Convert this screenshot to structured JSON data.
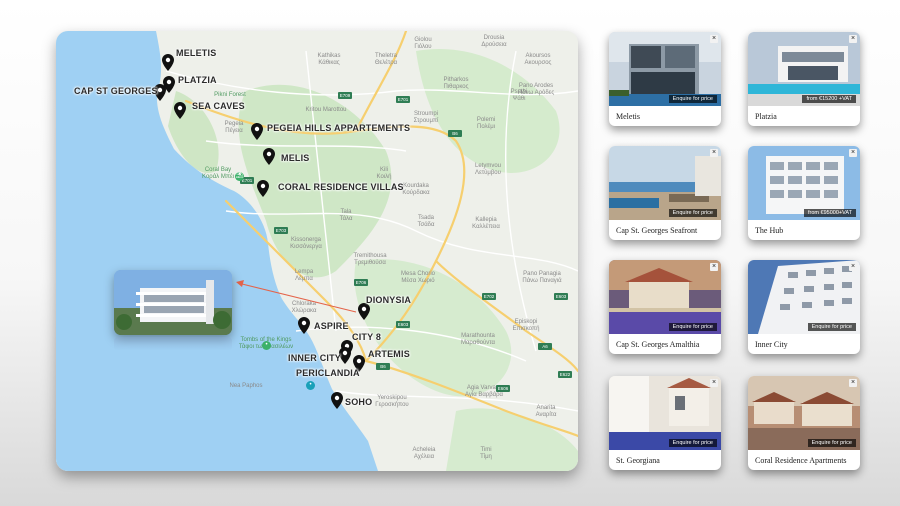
{
  "map": {
    "pins": [
      {
        "label": "MELETIS"
      },
      {
        "label": "PLATZIA"
      },
      {
        "label": "CAP ST GEORGES"
      },
      {
        "label": "SEA CAVES"
      },
      {
        "label": "PEGEIA HILLS APPARTEMENTS"
      },
      {
        "label": "MELIS"
      },
      {
        "label": "CORAL RESIDENCE VILLAS"
      },
      {
        "label": "DIONYSIA"
      },
      {
        "label": "ASPIRE"
      },
      {
        "label": "CITY 8"
      },
      {
        "label": "INNER CITY"
      },
      {
        "label": "ARTEMIS"
      },
      {
        "label": "PERICLANDIA"
      },
      {
        "label": "SOHO"
      }
    ],
    "places": [
      {
        "text": "Giolou\nΓιόλου"
      },
      {
        "text": "Drousia\nΔρούσεια"
      },
      {
        "text": "Kathikas\nΚάθικας"
      },
      {
        "text": "Theletra\nΘελέτρα"
      },
      {
        "text": "Akoursos\nΑκουρσος"
      },
      {
        "text": "Pano Arodes\nΠάνω Αρόδες"
      },
      {
        "text": "Pitharkos\nΠιθαρκος"
      },
      {
        "text": "Psathi\nΨάθι"
      },
      {
        "text": "Kritou Marottou"
      },
      {
        "text": "Pikni Forest"
      },
      {
        "text": "Pegeia\nΠέγεια"
      },
      {
        "text": "Stroumpi\nΣτρουμπί"
      },
      {
        "text": "Polemi\nΠολέμι"
      },
      {
        "text": "Kili\nΚοιλή"
      },
      {
        "text": "Letymvou\nΛετύμβου"
      },
      {
        "text": "Kourdaka\nΚούρδακα"
      },
      {
        "text": "Kallepia\nΚαλλέπεια"
      },
      {
        "text": "Tala\nΤάλα"
      },
      {
        "text": "Tsada\nΤσάδα"
      },
      {
        "text": "Coral Bay\nΚοράλ Μπέι"
      },
      {
        "text": "Kissonerga\nΚισσόνεργα"
      },
      {
        "text": "Tremithousa\nΤρεμιθούσα"
      },
      {
        "text": "Mesa Chorio\nΜέσα Χωριό"
      },
      {
        "text": "Lempa\nΛέμπα"
      },
      {
        "text": "Chloraka\nΧλώρακα"
      },
      {
        "text": "Marathounta\nΜαραθούντα"
      },
      {
        "text": "Tombs of the Kings\nΤάφοι των Βασιλέων"
      },
      {
        "text": "Nea Paphos"
      },
      {
        "text": "Agia Varvara\nΑγία Βαρβάρα"
      },
      {
        "text": "Yeroskipou\nΓεροσκήπου"
      },
      {
        "text": "Acheleia\nΑχέλεια"
      },
      {
        "text": "Timi\nΤίμη"
      },
      {
        "text": "Anarita\nΑναρίτα"
      },
      {
        "text": "Episkopi\nΕπισκοπή"
      },
      {
        "text": "Pano Panagia\nΠάνω Παναγιά"
      }
    ],
    "roads": [
      "E709",
      "E701",
      "B6",
      "E701",
      "E703",
      "E706",
      "E702",
      "E603",
      "E606",
      "E622",
      "B6",
      "A6",
      "E603"
    ]
  },
  "cards": [
    {
      "name": "Meletis",
      "tag": "Enquire for price"
    },
    {
      "name": "Platzia",
      "tag": "from €15200 +VAT"
    },
    {
      "name": "Cap St. Georges Seafront",
      "tag": "Enquire for price"
    },
    {
      "name": "The Hub",
      "tag": "from €95000+VAT"
    },
    {
      "name": "Cap St. Georges Amalthia",
      "tag": "Enquire for price"
    },
    {
      "name": "Inner City",
      "tag": "Enquire for price"
    },
    {
      "name": "St. Georgiana",
      "tag": "Enquire for price"
    },
    {
      "name": "Coral Residence Apartments",
      "tag": "Enquire for price"
    }
  ],
  "close_glyph": "×",
  "colors": {
    "sea": "#9fd0f3",
    "land": "#eef0ea",
    "green": "#c9e5c1",
    "road": "#f6cf6f",
    "pin": "#111111",
    "arrow": "#e4644a"
  }
}
